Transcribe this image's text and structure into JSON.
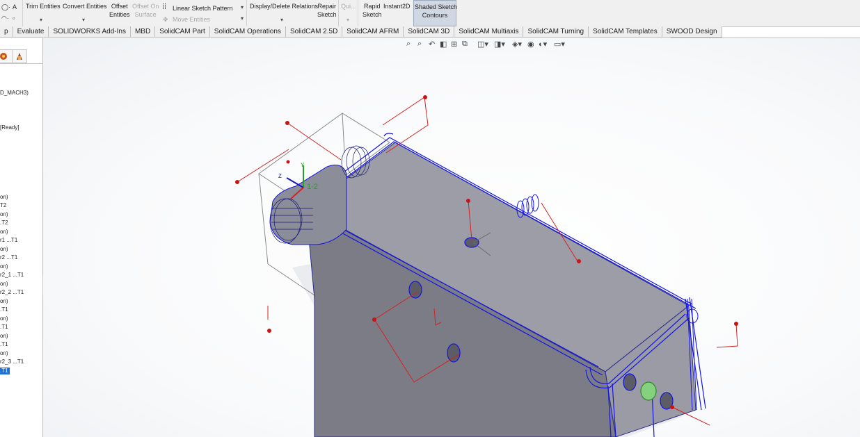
{
  "ribbon": {
    "trim_label": "Trim Entities",
    "convert_label": "Convert Entities",
    "offset_label": "Offset",
    "offset_label2": "Entities",
    "offset_surface_label": "Offset On",
    "offset_surface_label2": "Surface",
    "linear_pattern_label": "Linear Sketch Pattern",
    "move_entities_label": "Move Entities",
    "display_relations_label": "Display/Delete Relations",
    "repair_label": "Repair",
    "repair_label2": "Sketch",
    "quick_label": "Qui...",
    "rapid_label": "Rapid",
    "rapid_label2": "Sketch",
    "instant2d_label": "Instant2D",
    "shaded_label": "Shaded Sketch",
    "shaded_label2": "Contours"
  },
  "tabs": [
    {
      "label": "p"
    },
    {
      "label": "Evaluate"
    },
    {
      "label": "SOLIDWORKS Add-Ins"
    },
    {
      "label": "MBD"
    },
    {
      "label": "SolidCAM Part"
    },
    {
      "label": "SolidCAM Operations"
    },
    {
      "label": "SolidCAM 2.5D"
    },
    {
      "label": "SolidCAM AFRM"
    },
    {
      "label": "SolidCAM 3D"
    },
    {
      "label": "SolidCAM Multiaxis"
    },
    {
      "label": "SolidCAM Turning"
    },
    {
      "label": "SolidCAM Templates"
    },
    {
      "label": "SWOOD Design"
    }
  ],
  "tree": {
    "items": [
      "D_MACH3)",
      "[Ready]",
      "on)",
      "T2",
      "on)",
      ".T2",
      "on)",
      "r1 ...T1",
      "on)",
      "r2 ...T1",
      "on)",
      "r2_1 ...T1",
      "on)",
      "r2_2 ...T1",
      "on)",
      ".T1",
      "on)",
      ".T1",
      "on)",
      ".T1",
      "on)",
      "r2_3 ...T1",
      ".T1"
    ]
  },
  "triad": {
    "y_label": "Y",
    "z_label": "Z",
    "sketch_label": "1-2"
  },
  "colors": {
    "accent_selected": "#1f6ed4",
    "sketch_blue": "#1414e6",
    "sketch_red": "#d62020",
    "body_grey": "#7d7e88"
  },
  "icons": [
    "zoom-to-fit-icon",
    "zoom-area-icon",
    "previous-view-icon",
    "section-view-icon",
    "dynamic-annotation-icon",
    "view-orientation-icon",
    "display-style-icon",
    "hide-show-icon",
    "edit-appearance-icon",
    "apply-scene-icon",
    "view-settings-icon"
  ]
}
